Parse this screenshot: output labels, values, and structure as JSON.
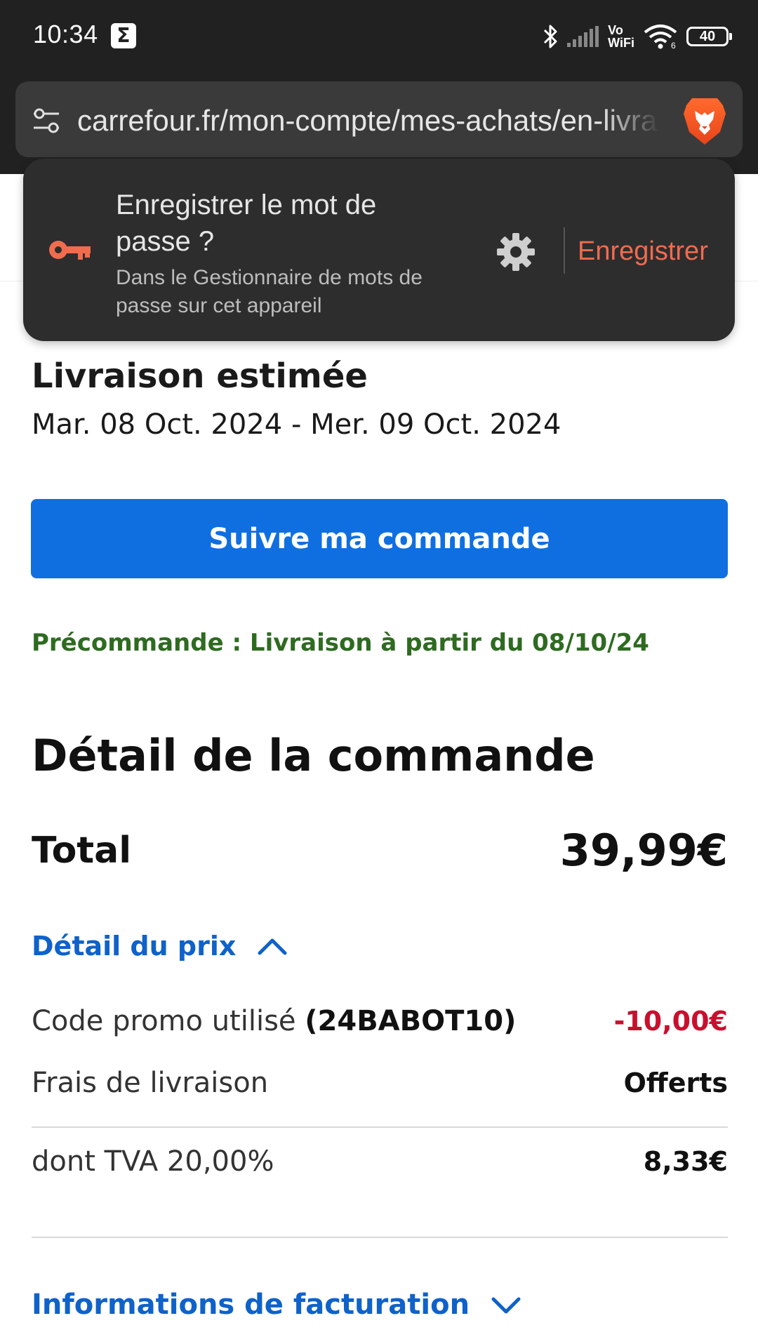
{
  "status_bar": {
    "time": "10:34",
    "notification_glyph": "Σ",
    "vowifi_line1": "Vo",
    "vowifi_line2": "WiFi",
    "battery": "40"
  },
  "browser": {
    "url": "carrefour.fr/mon-compte/mes-achats/en-livraison",
    "icons": [
      "tune-icon",
      "brave-lion-icon"
    ]
  },
  "password_prompt": {
    "title": "Enregistrer le mot de passe ?",
    "subtitle": "Dans le Gestionnaire de mots de passe sur cet appareil",
    "save_label": "Enregistrer",
    "icons": [
      "key-icon",
      "gear-icon"
    ],
    "accent_color": "#ef6c4f"
  },
  "delivery": {
    "title": "Livraison estimée",
    "dates": "Mar. 08 Oct. 2024 - Mer. 09 Oct. 2024"
  },
  "track_button_label": "Suivre ma commande",
  "preorder_note": "Précommande : Livraison à partir du 08/10/24",
  "order_detail": {
    "title": "Détail de la commande",
    "total_label": "Total",
    "total_value": "39,99€",
    "price_detail_label": "Détail du prix",
    "promo_label": "Code promo utilisé ",
    "promo_code": "(24BABOT10)",
    "promo_value": "-10,00€",
    "shipping_label": "Frais de livraison",
    "shipping_value": "Offerts",
    "vat_label": "dont TVA 20,00%",
    "vat_value": "8,33€",
    "billing_label": "Informations de facturation"
  },
  "colors": {
    "primary_button": "#0f6fe0",
    "link_blue": "#0f62c9",
    "preorder_green": "#2e6b21",
    "discount_red": "#c8102e"
  }
}
